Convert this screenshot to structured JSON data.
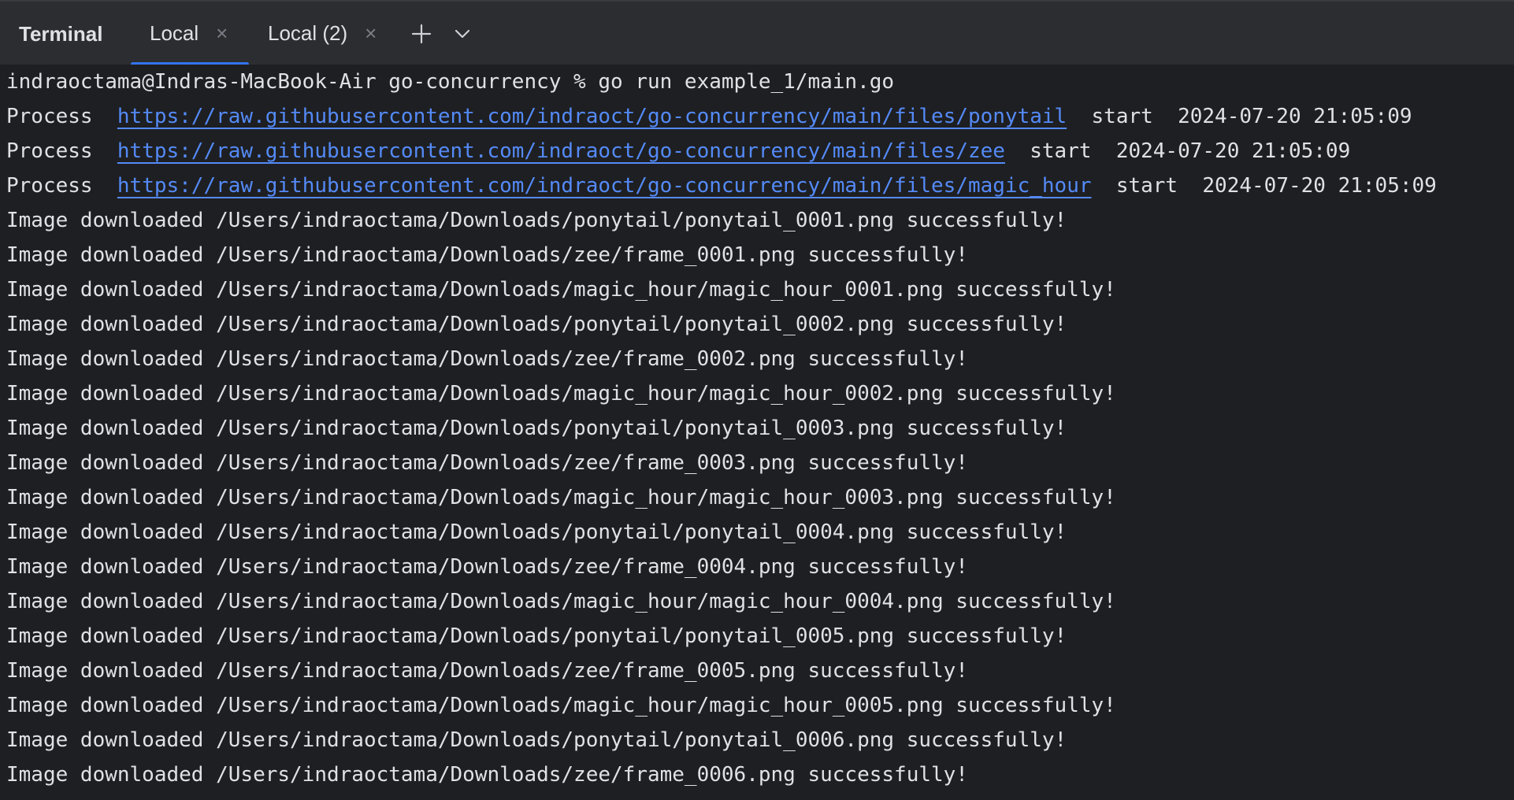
{
  "tabbar": {
    "title": "Terminal",
    "tabs": [
      {
        "label": "Local",
        "close": "×",
        "active": true
      },
      {
        "label": "Local (2)",
        "close": "×",
        "active": false
      }
    ],
    "new_tab_icon": "plus-icon",
    "dropdown_icon": "chevron-down-icon",
    "accent_color": "#3574f0"
  },
  "terminal": {
    "command_line": "indraoctama@Indras-MacBook-Air go-concurrency % go run example_1/main.go",
    "process_lines": [
      {
        "prefix": "Process  ",
        "url": "https://raw.githubusercontent.com/indraoct/go-concurrency/main/files/ponytail",
        "suffix": "  start  2024-07-20 21:05:09"
      },
      {
        "prefix": "Process  ",
        "url": "https://raw.githubusercontent.com/indraoct/go-concurrency/main/files/zee",
        "suffix": "  start  2024-07-20 21:05:09"
      },
      {
        "prefix": "Process  ",
        "url": "https://raw.githubusercontent.com/indraoct/go-concurrency/main/files/magic_hour",
        "suffix": "  start  2024-07-20 21:05:09"
      }
    ],
    "output_lines": [
      "Image downloaded /Users/indraoctama/Downloads/ponytail/ponytail_0001.png successfully!",
      "Image downloaded /Users/indraoctama/Downloads/zee/frame_0001.png successfully!",
      "Image downloaded /Users/indraoctama/Downloads/magic_hour/magic_hour_0001.png successfully!",
      "Image downloaded /Users/indraoctama/Downloads/ponytail/ponytail_0002.png successfully!",
      "Image downloaded /Users/indraoctama/Downloads/zee/frame_0002.png successfully!",
      "Image downloaded /Users/indraoctama/Downloads/magic_hour/magic_hour_0002.png successfully!",
      "Image downloaded /Users/indraoctama/Downloads/ponytail/ponytail_0003.png successfully!",
      "Image downloaded /Users/indraoctama/Downloads/zee/frame_0003.png successfully!",
      "Image downloaded /Users/indraoctama/Downloads/magic_hour/magic_hour_0003.png successfully!",
      "Image downloaded /Users/indraoctama/Downloads/ponytail/ponytail_0004.png successfully!",
      "Image downloaded /Users/indraoctama/Downloads/zee/frame_0004.png successfully!",
      "Image downloaded /Users/indraoctama/Downloads/magic_hour/magic_hour_0004.png successfully!",
      "Image downloaded /Users/indraoctama/Downloads/ponytail/ponytail_0005.png successfully!",
      "Image downloaded /Users/indraoctama/Downloads/zee/frame_0005.png successfully!",
      "Image downloaded /Users/indraoctama/Downloads/magic_hour/magic_hour_0005.png successfully!",
      "Image downloaded /Users/indraoctama/Downloads/ponytail/ponytail_0006.png successfully!",
      "Image downloaded /Users/indraoctama/Downloads/zee/frame_0006.png successfully!"
    ],
    "link_color": "#548af7",
    "text_color": "#dfe1e5",
    "background_color": "#1e1f22"
  }
}
